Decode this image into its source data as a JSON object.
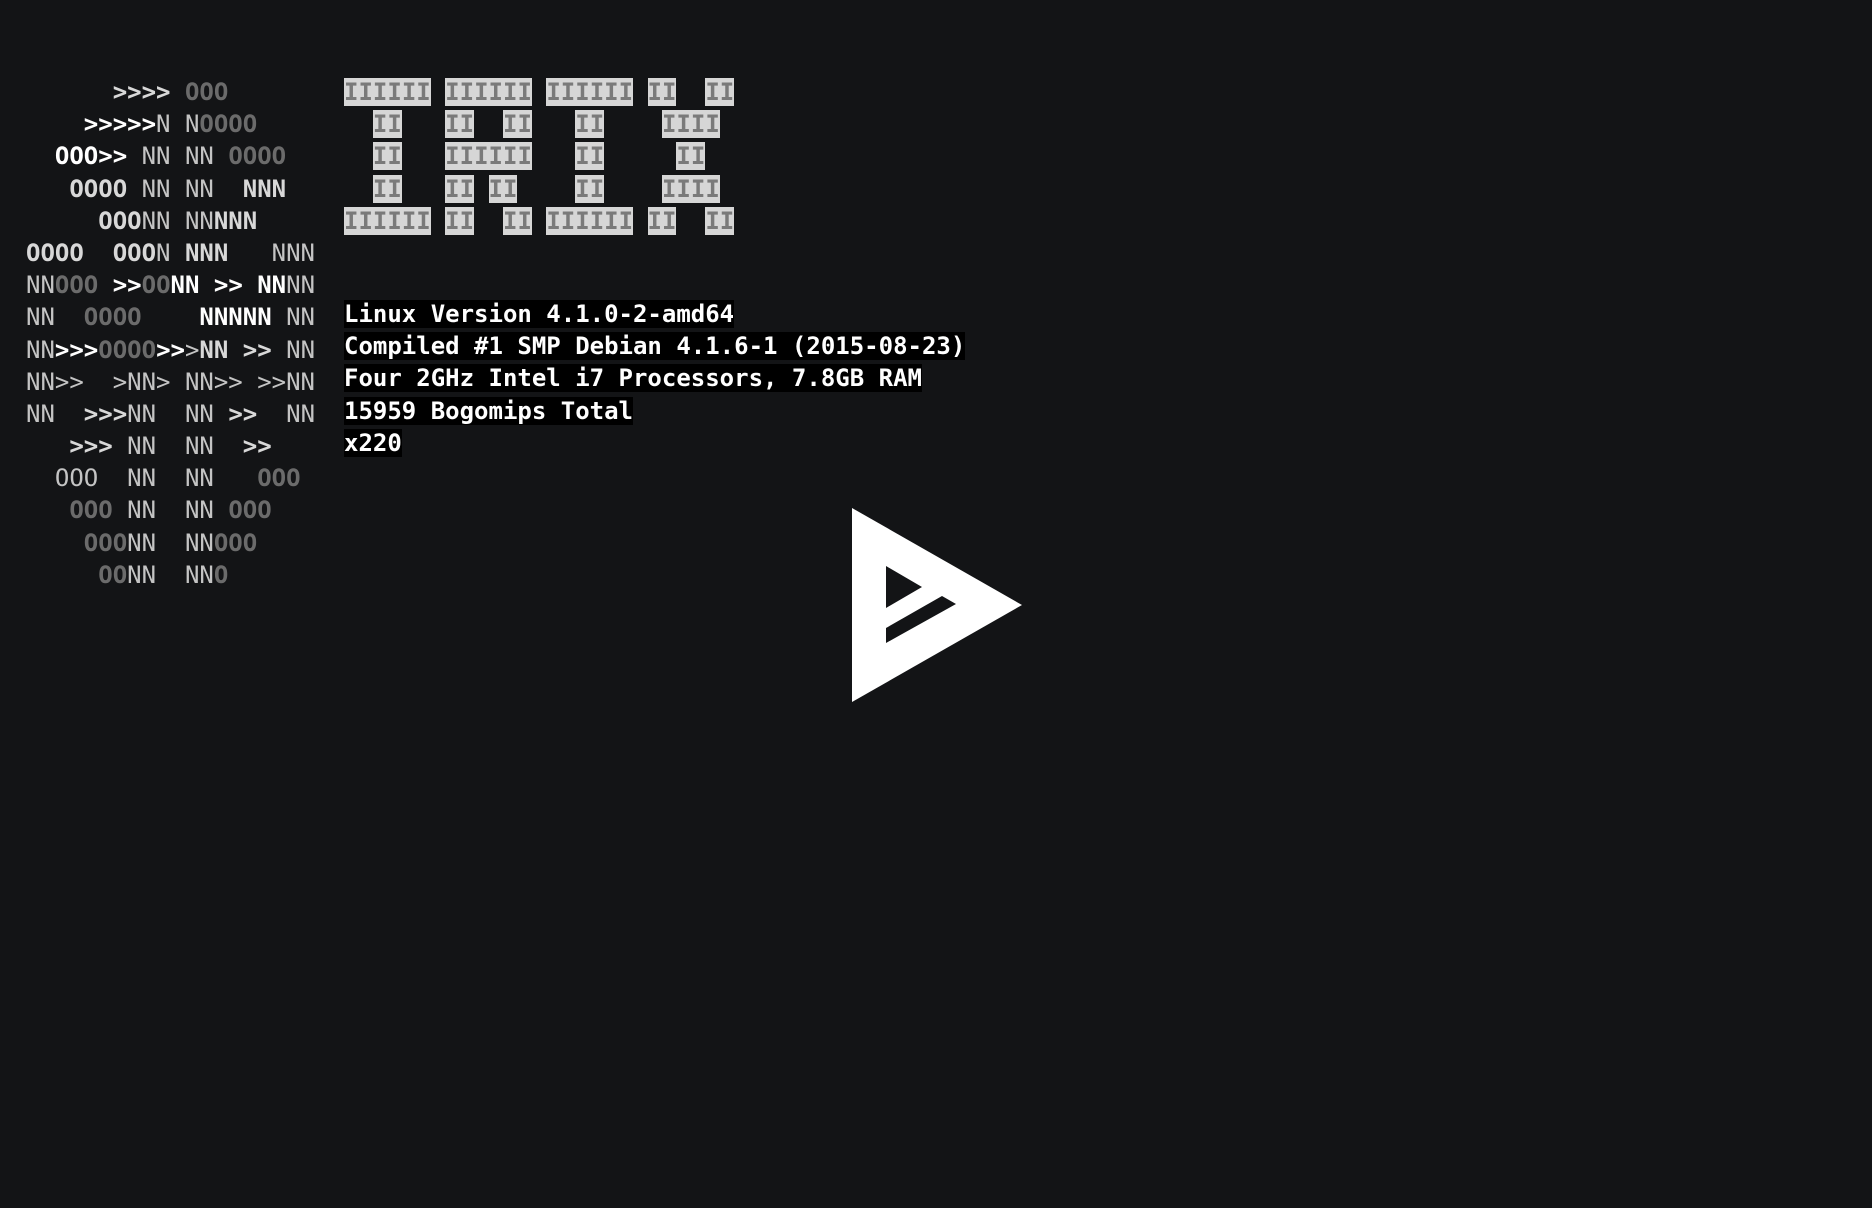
{
  "ascii_logo": {
    "lines": [
      [
        [
          "      ",
          "l"
        ],
        [
          ">>>>",
          "b"
        ],
        [
          " ",
          "l"
        ],
        [
          "OOO",
          "d"
        ]
      ],
      [
        [
          "    ",
          "l"
        ],
        [
          ">>>>>",
          "w"
        ],
        [
          "N N",
          "l"
        ],
        [
          "OOOO",
          "d"
        ]
      ],
      [
        [
          "  ",
          "l"
        ],
        [
          "OOO>>",
          "w"
        ],
        [
          " NN NN ",
          "l"
        ],
        [
          "OOOO",
          "d"
        ]
      ],
      [
        [
          "   ",
          "l"
        ],
        [
          "OOOO",
          "b"
        ],
        [
          " NN NN  ",
          "l"
        ],
        [
          "NNN",
          "b"
        ]
      ],
      [
        [
          "     ",
          "l"
        ],
        [
          "OOO",
          "b"
        ],
        [
          "NN NN",
          "l"
        ],
        [
          "NNN",
          "b"
        ]
      ],
      [
        [
          "OOOO  OOO",
          "b"
        ],
        [
          "N ",
          "l"
        ],
        [
          "NNN",
          "b"
        ],
        [
          "   N",
          "l"
        ],
        [
          "NN",
          "l"
        ]
      ],
      [
        [
          "NN",
          "l"
        ],
        [
          "OOO",
          "d"
        ],
        [
          " ",
          "l"
        ],
        [
          ">>",
          "w"
        ],
        [
          "OO",
          "d"
        ],
        [
          "NN >> NN",
          "w"
        ],
        [
          "NN",
          "l"
        ]
      ],
      [
        [
          "NN  ",
          "l"
        ],
        [
          "OOOO",
          "d"
        ],
        [
          "    ",
          "l"
        ],
        [
          "NNNNN",
          "w"
        ],
        [
          " NN",
          "l"
        ]
      ],
      [
        [
          "NN",
          "l"
        ],
        [
          ">>>",
          "w"
        ],
        [
          "OOOO",
          "d"
        ],
        [
          ">>",
          "w"
        ],
        [
          ">",
          "l"
        ],
        [
          "NN",
          "b"
        ],
        [
          " ",
          "l"
        ],
        [
          ">>",
          "b"
        ],
        [
          " NN",
          "l"
        ]
      ],
      [
        [
          "NN>>  >NN> NN>> >>NN",
          "l"
        ]
      ],
      [
        [
          "NN  ",
          "l"
        ],
        [
          ">>>",
          "b"
        ],
        [
          "NN  NN ",
          "l"
        ],
        [
          ">>",
          "b"
        ],
        [
          "  NN",
          "l"
        ]
      ],
      [
        [
          "   ",
          "l"
        ],
        [
          ">>>",
          "b"
        ],
        [
          " NN  NN  ",
          "l"
        ],
        [
          ">>",
          "b"
        ]
      ],
      [
        [
          "  OOO  NN  NN   ",
          "l"
        ],
        [
          "OOO",
          "d"
        ]
      ],
      [
        [
          "   ",
          "l"
        ],
        [
          "OOO",
          "d"
        ],
        [
          " NN  NN ",
          "l"
        ],
        [
          "OOO",
          "d"
        ]
      ],
      [
        [
          "    ",
          "l"
        ],
        [
          "OOO",
          "d"
        ],
        [
          "NN  NN",
          "l"
        ],
        [
          "OOO",
          "d"
        ]
      ],
      [
        [
          "     ",
          "l"
        ],
        [
          "OO",
          "d"
        ],
        [
          "NN  NN",
          "l"
        ],
        [
          "O",
          "d"
        ]
      ]
    ]
  },
  "irix_banner": {
    "lines": [
      "IIIIII IIIIII IIIIII II  II",
      "  II   II  II   II    IIII ",
      "  II   IIIIII   II     II  ",
      "  II   II II    II    IIII ",
      "IIIIII II  II IIIIII II  II"
    ],
    "mask": [
      "111111 111111 111111 11  11",
      "  11   11  11   11    1111 ",
      "  11   111111   11     11  ",
      "  11   11 11    11    1111 ",
      "111111 11  11 111111 11  11"
    ]
  },
  "system_info": {
    "kernel": "Linux Version 4.1.0-2-amd64",
    "compiled": "Compiled #1 SMP Debian 4.1.6-1 (2015-08-23)",
    "hardware": "Four 2GHz Intel i7 Processors, 7.8GB RAM",
    "bogomips": "15959 Bogomips Total",
    "hostname": "x220"
  },
  "logo_icon": "asciinema-play-icon",
  "colors": {
    "background": "#131416",
    "text": "#ffffff",
    "dim": "#6b6b6b",
    "banner_bg": "#d6d6d6"
  }
}
